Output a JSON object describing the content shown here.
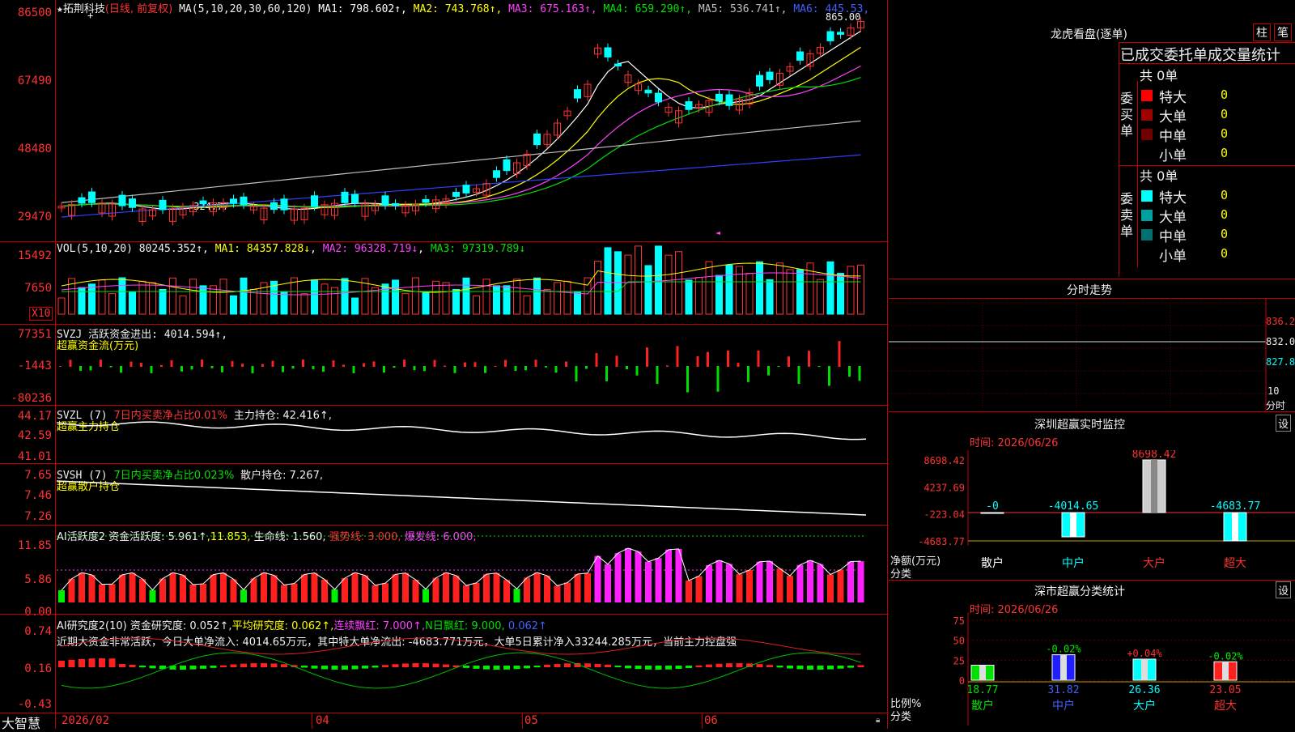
{
  "stock": {
    "name": "拓荆科技",
    "mode": "(日线, 前复权)",
    "ma_label": "MA(5,10,20,30,60,120)",
    "ma": [
      {
        "k": "MA1:",
        "v": "798.602↑",
        "c": "#ffffff"
      },
      {
        "k": "MA2:",
        "v": "743.768↑",
        "c": "#ffff00"
      },
      {
        "k": "MA3:",
        "v": "675.163↑",
        "c": "#ff40ff"
      },
      {
        "k": "MA4:",
        "v": "659.290↑",
        "c": "#00e000"
      },
      {
        "k": "MA5:",
        "v": "536.741↑",
        "c": "#c0c0c0"
      },
      {
        "k": "MA6:",
        "v": "445.53",
        "c": "#4060ff"
      }
    ],
    "high_mark": "865.00",
    "low_mark": "←324.77"
  },
  "price_axis": [
    "86500",
    "67490",
    "48480",
    "29470"
  ],
  "vol": {
    "title": "VOL(5,10,20)",
    "value": "80245.352↑",
    "ma1": "MA1: 84357.828↓",
    "ma2": "MA2: 96328.719↓",
    "ma3": "MA3: 97319.789↓",
    "axis": [
      "15492",
      "7650"
    ],
    "unit": "X10"
  },
  "svzj": {
    "title": "SVZJ  活跃资金进出: 4014.594↑,",
    "sub": "超赢资金流(万元)",
    "axis": [
      "77351",
      "-1443",
      "-80236"
    ]
  },
  "svzl": {
    "title": "SVZL (7) ",
    "pct": "7日内买卖净占比0.01%",
    "hold": "主力持仓: 42.416↑,",
    "sub": "超赢主力持仓",
    "axis": [
      "44.17",
      "42.59",
      "41.01"
    ]
  },
  "svsh": {
    "title": "SVSH (7) ",
    "pct": "7日内买卖净占比0.023%",
    "hold": "散户持仓: 7.267,",
    "sub": "超赢散户持仓",
    "axis": [
      "7.65",
      "7.46",
      "7.26"
    ]
  },
  "ai1": {
    "title": "AI活跃度2 资金活跃度: 5.961↑",
    "v2": ",11.853,",
    "life": "生命线: 1.560,",
    "strong": "强势线: 3.000,",
    "burst": "爆发线: 6.000,",
    "axis": [
      "11.85",
      "5.86",
      "0.00"
    ]
  },
  "ai2": {
    "title": "AI研究度2(10) 资金研究度: 0.052↑,",
    "avg": "平均研究度: 0.062↑,",
    "cont": "连续飘红: 7.000↑,",
    "nday": "N日飘红: 9.000,",
    "extra": "0.062↑",
    "note": "近期大资金非常活跃，今日大单净流入: 4014.65万元，其中特大单净流出: -4683.771万元，大单5日累计净入33244.285万元，当前主力控盘强",
    "axis": [
      "0.74",
      "0.16",
      "-0.43"
    ]
  },
  "date_axis": [
    "2026/02",
    "04",
    "05",
    "06"
  ],
  "brand": "大智慧",
  "right": {
    "title": "龙虎看盘(逐单)",
    "btn_bar": "柱",
    "btn_pen": "笔",
    "tabs": "已成交委托单成交量统计",
    "buy": {
      "label": "委买单",
      "total": "共 0单",
      "rows": [
        {
          "n": "特大",
          "v": "0",
          "c": "#ff0000"
        },
        {
          "n": "大单",
          "v": "0",
          "c": "#a00000"
        },
        {
          "n": "中单",
          "v": "0",
          "c": "#700000"
        },
        {
          "n": "小单",
          "v": "0",
          "c": "#000000"
        }
      ]
    },
    "sell": {
      "label": "委卖单",
      "total": "共 0单",
      "rows": [
        {
          "n": "特大",
          "v": "0",
          "c": "#00ffff"
        },
        {
          "n": "大单",
          "v": "0",
          "c": "#00a0a0"
        },
        {
          "n": "中单",
          "v": "0",
          "c": "#007070"
        },
        {
          "n": "小单",
          "v": "0",
          "c": "#000000"
        }
      ]
    },
    "intraday": {
      "title": "分时走势",
      "axis": [
        "836.2",
        "832.0",
        "827.8"
      ],
      "bottom": "10",
      "bottom2": "分时"
    },
    "sz": {
      "title": "深圳超赢实时监控",
      "set": "设",
      "time": "时间: 2026/06/26",
      "axis": [
        "8698.42",
        "4237.69",
        "-223.04",
        "-4683.77"
      ],
      "ylabel": "净额(万元)",
      "ylabel2": "分类",
      "bars": [
        {
          "cat": "散户",
          "label": "-0",
          "v": 0
        },
        {
          "cat": "中户",
          "label": "-4014.65",
          "v": -4014.65
        },
        {
          "cat": "大户",
          "label": "8698.42",
          "v": 8698.42
        },
        {
          "cat": "超大",
          "label": "-4683.77",
          "v": -4683.77
        }
      ]
    },
    "sc": {
      "title": "深市超赢分类统计",
      "set": "设",
      "time": "时间: 2026/06/26",
      "axis": [
        "75",
        "50",
        "25",
        "0"
      ],
      "ylabel": "比例%",
      "ylabel2": "分类",
      "bars": [
        {
          "cat": "散户",
          "top": "",
          "val": "18.77",
          "v": 18.77,
          "c": "#00e000"
        },
        {
          "cat": "中户",
          "top": "-0.02%",
          "val": "31.82",
          "v": 31.82,
          "c": "#2020ff"
        },
        {
          "cat": "大户",
          "top": "+0.04%",
          "val": "26.36",
          "v": 26.36,
          "c": "#00ffff"
        },
        {
          "cat": "超大",
          "top": "-0.02%",
          "val": "23.05",
          "v": 23.05,
          "c": "#ff2020"
        }
      ]
    }
  }
}
